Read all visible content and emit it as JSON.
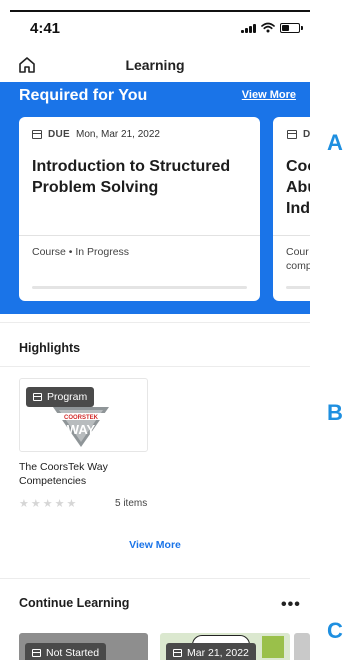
{
  "status_bar": {
    "time": "4:41"
  },
  "nav": {
    "title": "Learning"
  },
  "required": {
    "title": "Required for You",
    "view_more": "View More",
    "cards": [
      {
        "due_label": "DUE",
        "due_date": "Mon, Mar 21, 2022",
        "title": "Introduction to Structured Problem Solving",
        "meta": "Course • In Progress",
        "progress": 0
      },
      {
        "due_label": "D",
        "title_lines": [
          "Coo",
          "Abu",
          "Ind"
        ],
        "meta_lines": [
          "Cour",
          "comp"
        ]
      }
    ]
  },
  "highlights": {
    "title": "Highlights",
    "item": {
      "badge": "Program",
      "logo_text_top": "COORSTEK",
      "logo_text_main": "WAY",
      "name": "The CoorsTek Way Competencies",
      "rating": 0,
      "items_count": "5 items"
    },
    "view_more": "View More"
  },
  "continue_learning": {
    "title": "Continue Learning",
    "more": "•••",
    "tiles": [
      {
        "badge": "Not Started"
      },
      {
        "badge": "Mar 21, 2022"
      }
    ]
  },
  "side_letters": [
    "A",
    "B",
    "C"
  ],
  "colors": {
    "accent": "#1a74e8",
    "side_letter": "#1e8fe0",
    "badge": "#4a4a4a"
  },
  "icons": [
    "home-icon",
    "calendar-icon",
    "star-icon",
    "more-icon",
    "signal-icon",
    "wifi-icon",
    "battery-icon"
  ]
}
